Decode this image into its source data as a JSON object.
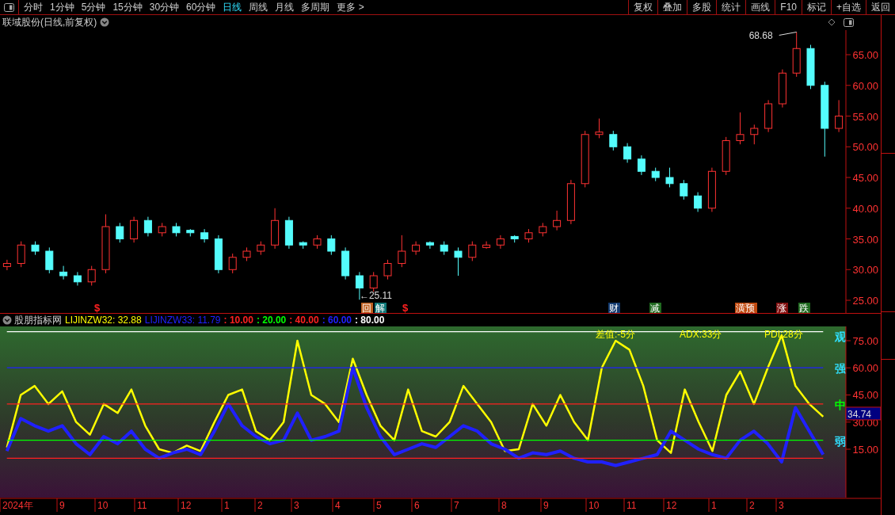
{
  "toolbar": {
    "periods": [
      {
        "label": "分时",
        "selected": false
      },
      {
        "label": "1分钟",
        "selected": false
      },
      {
        "label": "5分钟",
        "selected": false
      },
      {
        "label": "15分钟",
        "selected": false
      },
      {
        "label": "30分钟",
        "selected": false
      },
      {
        "label": "60分钟",
        "selected": false
      },
      {
        "label": "日线",
        "selected": true
      },
      {
        "label": "周线",
        "selected": false
      },
      {
        "label": "月线",
        "selected": false
      },
      {
        "label": "多周期",
        "selected": false
      },
      {
        "label": "更多 >",
        "selected": false
      }
    ],
    "actions": [
      "复权",
      "叠加",
      "多股",
      "统计",
      "画线",
      "F10",
      "标记",
      "+自选",
      "返回"
    ]
  },
  "price_panel": {
    "title": "联域股份(日线,前复权)",
    "high_label": "68.68",
    "low_label": "←25.11",
    "events": [
      {
        "kind": "mark",
        "label": "$",
        "color": "#ff2020"
      },
      {
        "kind": "badge",
        "label": "回",
        "color": "#c06020"
      },
      {
        "kind": "badge",
        "label": "解",
        "color": "#107878"
      },
      {
        "kind": "mark",
        "label": "$",
        "color": "#ff2020"
      },
      {
        "kind": "badge",
        "label": "财",
        "color": "#123a70"
      },
      {
        "kind": "badge",
        "label": "减",
        "color": "#206a20"
      },
      {
        "kind": "badge",
        "label": "潢预",
        "color": "#c04a10"
      },
      {
        "kind": "badge",
        "label": "涨",
        "color": "#801010"
      },
      {
        "kind": "badge",
        "label": "跌",
        "color": "#206a20"
      }
    ],
    "chart_data": {
      "type": "candlestick",
      "ylim": [
        22.81,
        69
      ],
      "yticks": [
        {
          "value": 25,
          "label": "25.00"
        },
        {
          "value": 30,
          "label": "30.00"
        },
        {
          "value": 35,
          "label": "35.00"
        },
        {
          "value": 40,
          "label": "40.00"
        },
        {
          "value": 45,
          "label": "45.00"
        },
        {
          "value": 50,
          "label": "50.00"
        },
        {
          "value": 55,
          "label": "55.00"
        },
        {
          "value": 60,
          "label": "60.00"
        },
        {
          "value": 65,
          "label": "65.00"
        }
      ],
      "ohlc": [
        [
          30.5,
          31.6,
          29.9,
          31
        ],
        [
          31,
          34.6,
          30.4,
          34
        ],
        [
          34,
          34.6,
          32.4,
          33
        ],
        [
          33,
          33.6,
          29.4,
          30
        ],
        [
          29.6,
          30.6,
          28.4,
          29
        ],
        [
          29,
          29.6,
          27.4,
          28
        ],
        [
          28,
          30.6,
          27.4,
          30
        ],
        [
          30,
          39,
          29.4,
          37
        ],
        [
          37,
          37.6,
          34.4,
          35
        ],
        [
          35,
          38.6,
          34.4,
          38
        ],
        [
          38,
          38.6,
          35.4,
          36
        ],
        [
          36,
          37.6,
          35.4,
          37
        ],
        [
          37,
          37.6,
          35.4,
          36
        ],
        [
          36.4,
          36.6,
          35.4,
          36
        ],
        [
          36,
          36.6,
          34.4,
          35
        ],
        [
          35,
          35.6,
          29.4,
          30
        ],
        [
          30,
          32.6,
          29.4,
          32
        ],
        [
          32,
          33.6,
          31.4,
          33
        ],
        [
          33,
          34.6,
          32.4,
          34
        ],
        [
          34,
          40,
          33.4,
          38
        ],
        [
          38,
          38.6,
          33.4,
          34
        ],
        [
          34.4,
          34.6,
          33.4,
          34
        ],
        [
          34,
          35.6,
          33.4,
          35
        ],
        [
          35,
          35.6,
          32.4,
          33
        ],
        [
          33,
          33.6,
          28.4,
          29
        ],
        [
          29,
          29.6,
          25.1,
          27
        ],
        [
          27,
          29.6,
          26.4,
          29
        ],
        [
          29,
          31.6,
          28.4,
          31
        ],
        [
          31,
          35.6,
          30.4,
          33
        ],
        [
          33,
          34.6,
          32.4,
          34
        ],
        [
          34.4,
          34.6,
          33.4,
          34
        ],
        [
          34,
          34.6,
          32.4,
          33
        ],
        [
          33,
          33.6,
          29,
          32
        ],
        [
          32,
          34.6,
          31.4,
          34
        ],
        [
          33.6,
          34.6,
          33.4,
          34
        ],
        [
          34,
          35.6,
          33.4,
          35
        ],
        [
          35.4,
          35.6,
          34.4,
          35
        ],
        [
          35,
          36.6,
          34.4,
          36
        ],
        [
          36,
          37.6,
          35.4,
          37
        ],
        [
          37,
          39.6,
          36.4,
          38
        ],
        [
          38,
          44.6,
          37.4,
          44
        ],
        [
          44,
          52.6,
          43.4,
          52
        ],
        [
          52,
          54.6,
          51.4,
          52.4
        ],
        [
          52,
          52.6,
          49.4,
          50
        ],
        [
          50,
          50.6,
          47.4,
          48
        ],
        [
          48,
          48.6,
          45.4,
          46
        ],
        [
          46,
          46.6,
          44.4,
          45
        ],
        [
          45,
          46.6,
          43.4,
          44
        ],
        [
          44,
          44.6,
          41.4,
          42
        ],
        [
          42,
          42.6,
          39.4,
          40
        ],
        [
          40,
          46.6,
          39.4,
          46
        ],
        [
          46,
          51.6,
          45.4,
          51
        ],
        [
          51,
          55.6,
          50.4,
          52
        ],
        [
          52,
          53.6,
          50.4,
          53
        ],
        [
          53,
          57.6,
          52.4,
          57
        ],
        [
          57,
          62.6,
          56.4,
          62
        ],
        [
          62,
          68.68,
          61.4,
          66
        ],
        [
          66,
          66.6,
          59.4,
          60
        ],
        [
          60,
          60.6,
          48.4,
          53
        ],
        [
          53,
          57.6,
          52.4,
          55
        ]
      ]
    }
  },
  "indicator_panel": {
    "name": "股朋指标网",
    "series_readings": [
      ": 32.88",
      ": 11.79",
      ": 10.00",
      ": 20.00",
      ": 40.00",
      ": 60.00",
      ": 80.00"
    ],
    "current_value": "34.74",
    "overlay_labels": [
      "差值:-5分",
      "ADX:33分",
      "PDI:28分"
    ],
    "zone_labels": [
      {
        "label": "观",
        "color": "#30e0ff"
      },
      {
        "label": "强",
        "color": "#30e0ff"
      },
      {
        "label": "中",
        "color": "#00ff00"
      },
      {
        "label": "弱",
        "color": "#30e0ff"
      }
    ],
    "time_axis": [
      "2024年",
      "9",
      "10",
      "11",
      "12",
      "1",
      "2",
      "3",
      "4",
      "5",
      "6",
      "7",
      "8",
      "9",
      "10",
      "11",
      "12",
      "1",
      "2",
      "3"
    ],
    "chart_data": {
      "type": "line",
      "ylim": [
        -11.72,
        82.88
      ],
      "yticks": [
        {
          "value": 15,
          "label": "15.00"
        },
        {
          "value": 30,
          "label": "30.00"
        },
        {
          "value": 45,
          "label": "45.00"
        },
        {
          "value": 60,
          "label": "60.00"
        },
        {
          "value": 75,
          "label": "75.00"
        }
      ],
      "series": [
        {
          "name": "LIJINZW32",
          "color": "#ffff00",
          "values": [
            16,
            45,
            50,
            40,
            47,
            30,
            23,
            40,
            35,
            48,
            28,
            15,
            13,
            17,
            14,
            30,
            45,
            48,
            25,
            20,
            30,
            75,
            45,
            40,
            30,
            65,
            45,
            28,
            20,
            48,
            25,
            22,
            30,
            50,
            40,
            30,
            14,
            15,
            40,
            28,
            45,
            30,
            20,
            60,
            75,
            70,
            50,
            20,
            13,
            48,
            30,
            14,
            45,
            58,
            40,
            60,
            78,
            50,
            40,
            33
          ]
        },
        {
          "name": "LIJINZW33",
          "color": "#2020ff",
          "values": [
            14,
            32,
            28,
            25,
            28,
            18,
            12,
            22,
            18,
            25,
            15,
            10,
            13,
            15,
            12,
            25,
            40,
            28,
            22,
            18,
            20,
            35,
            20,
            22,
            25,
            60,
            38,
            22,
            12,
            15,
            18,
            16,
            22,
            28,
            25,
            18,
            15,
            10,
            13,
            12,
            14,
            10,
            8,
            8,
            6,
            8,
            10,
            12,
            25,
            20,
            15,
            12,
            10,
            20,
            25,
            18,
            8,
            38,
            25,
            12
          ]
        },
        {
          "color": "#ff2020",
          "values": [
            10,
            10,
            10,
            10,
            10,
            10,
            10,
            10,
            10,
            10,
            10,
            10,
            10,
            10,
            10,
            10,
            10,
            10,
            10,
            10,
            10,
            10,
            10,
            10,
            10,
            10,
            10,
            10,
            10,
            10,
            10,
            10,
            10,
            10,
            10,
            10,
            10,
            10,
            10,
            10,
            10,
            10,
            10,
            10,
            10,
            10,
            10,
            10,
            10,
            10,
            10,
            10,
            10,
            10,
            10,
            10,
            10,
            10,
            10,
            10
          ]
        },
        {
          "color": "#00ff00",
          "values": [
            20,
            20,
            20,
            20,
            20,
            20,
            20,
            20,
            20,
            20,
            20,
            20,
            20,
            20,
            20,
            20,
            20,
            20,
            20,
            20,
            20,
            20,
            20,
            20,
            20,
            20,
            20,
            20,
            20,
            20,
            20,
            20,
            20,
            20,
            20,
            20,
            20,
            20,
            20,
            20,
            20,
            20,
            20,
            20,
            20,
            20,
            20,
            20,
            20,
            20,
            20,
            20,
            20,
            20,
            20,
            20,
            20,
            20,
            20,
            20
          ]
        },
        {
          "color": "#ff2020",
          "values": [
            40,
            40,
            40,
            40,
            40,
            40,
            40,
            40,
            40,
            40,
            40,
            40,
            40,
            40,
            40,
            40,
            40,
            40,
            40,
            40,
            40,
            40,
            40,
            40,
            40,
            40,
            40,
            40,
            40,
            40,
            40,
            40,
            40,
            40,
            40,
            40,
            40,
            40,
            40,
            40,
            40,
            40,
            40,
            40,
            40,
            40,
            40,
            40,
            40,
            40,
            40,
            40,
            40,
            40,
            40,
            40,
            40,
            40,
            40,
            40
          ]
        },
        {
          "color": "#2020ff",
          "values": [
            60,
            60,
            60,
            60,
            60,
            60,
            60,
            60,
            60,
            60,
            60,
            60,
            60,
            60,
            60,
            60,
            60,
            60,
            60,
            60,
            60,
            60,
            60,
            60,
            60,
            60,
            60,
            60,
            60,
            60,
            60,
            60,
            60,
            60,
            60,
            60,
            60,
            60,
            60,
            60,
            60,
            60,
            60,
            60,
            60,
            60,
            60,
            60,
            60,
            60,
            60,
            60,
            60,
            60,
            60,
            60,
            60,
            60,
            60,
            60
          ]
        },
        {
          "color": "#ffffff",
          "values": [
            80,
            80,
            80,
            80,
            80,
            80,
            80,
            80,
            80,
            80,
            80,
            80,
            80,
            80,
            80,
            80,
            80,
            80,
            80,
            80,
            80,
            80,
            80,
            80,
            80,
            80,
            80,
            80,
            80,
            80,
            80,
            80,
            80,
            80,
            80,
            80,
            80,
            80,
            80,
            80,
            80,
            80,
            80,
            80,
            80,
            80,
            80,
            80,
            80,
            80,
            80,
            80,
            80,
            80,
            80,
            80,
            80,
            80,
            80,
            80
          ]
        }
      ]
    }
  }
}
